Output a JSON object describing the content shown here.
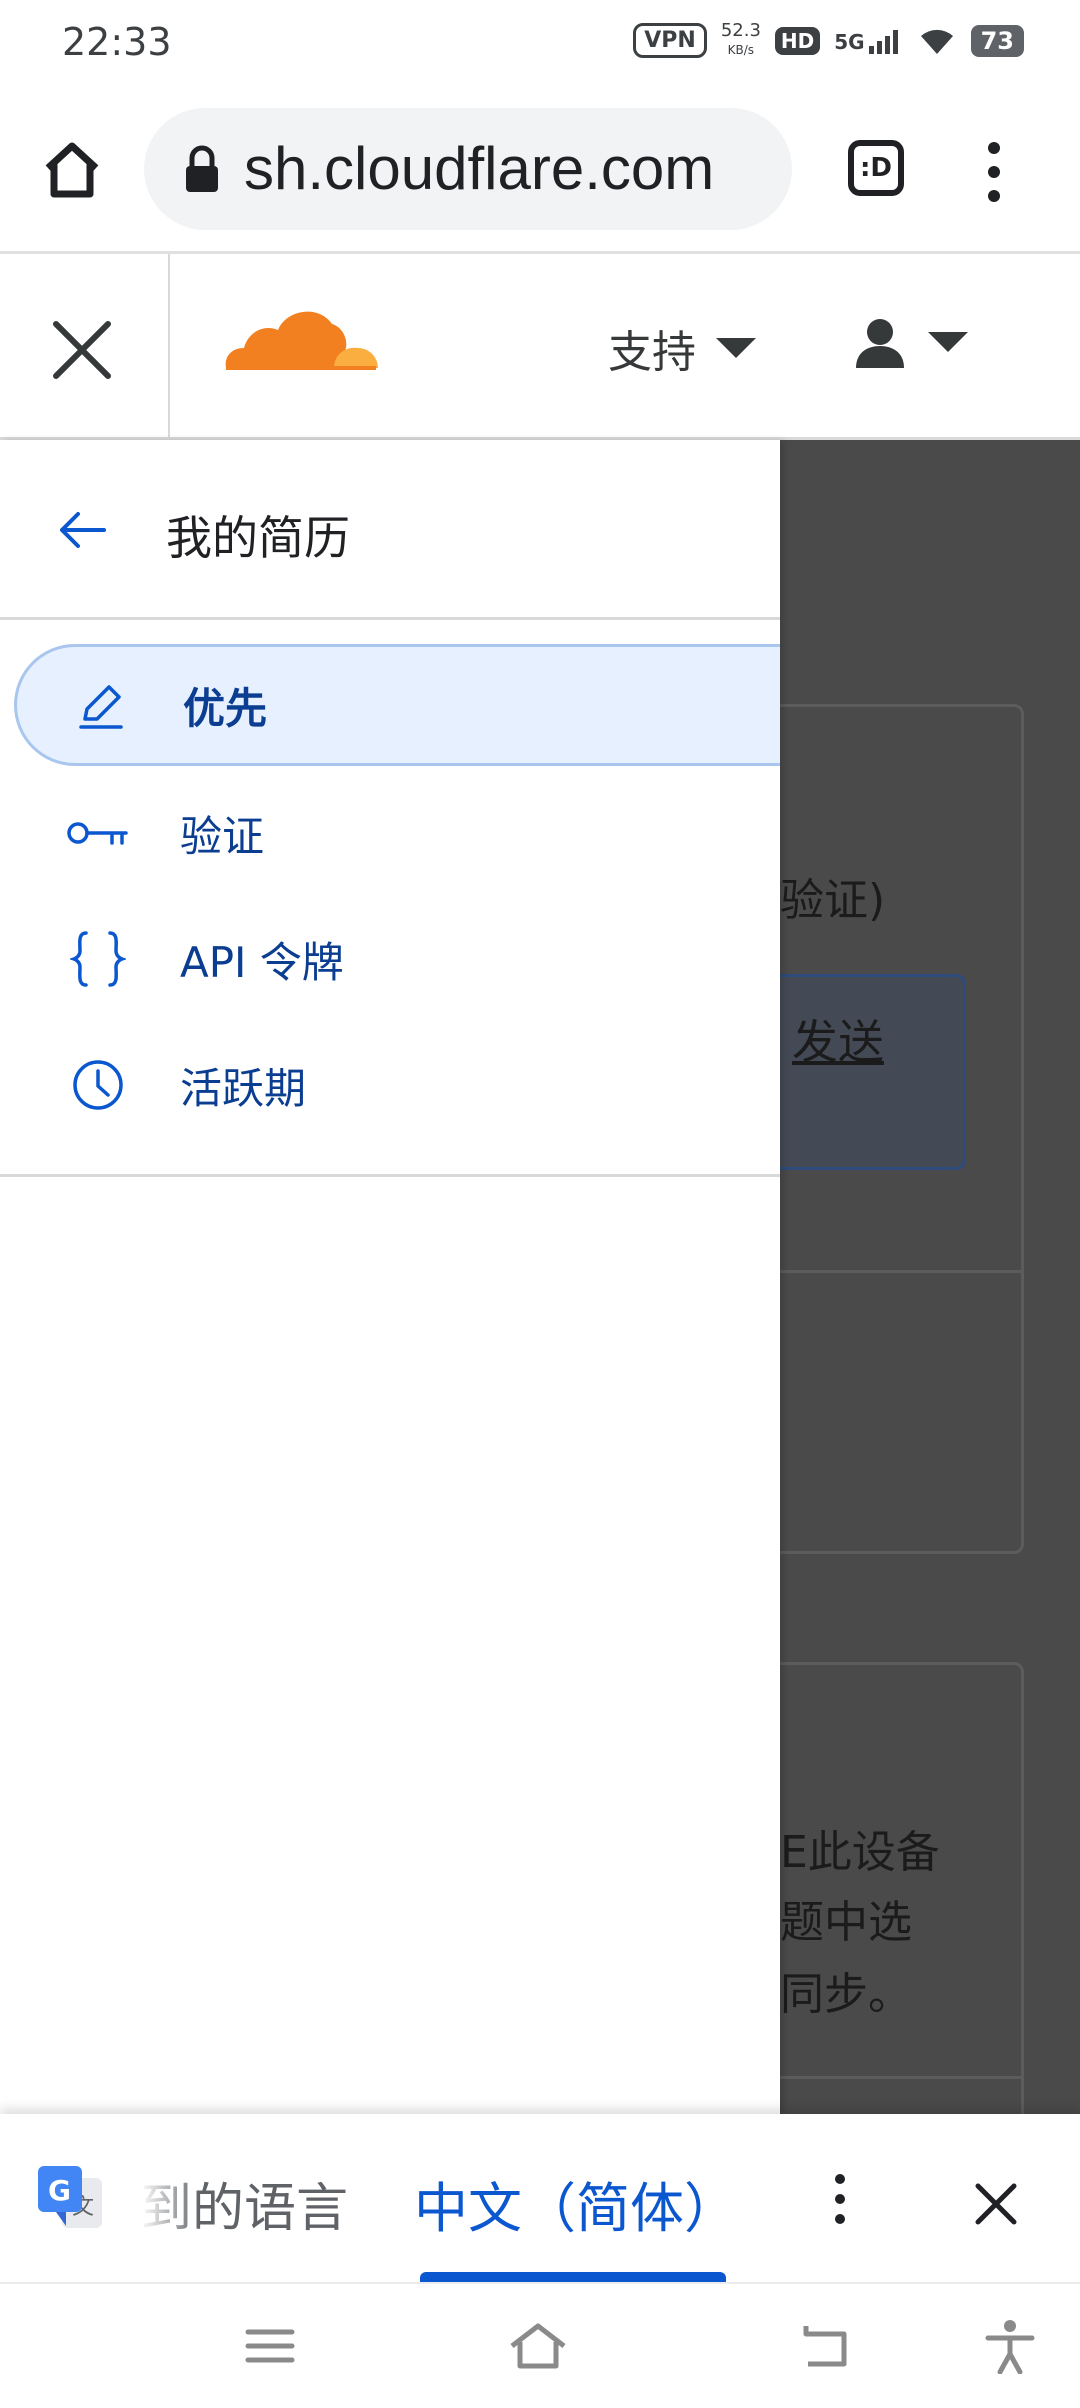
{
  "status_bar": {
    "time": "22:33",
    "vpn": "VPN",
    "net_speed_value": "52.3",
    "net_speed_unit": "KB/s",
    "hd": "HD",
    "network": "5G",
    "battery": "73"
  },
  "browser": {
    "url": "sh.cloudflare.com",
    "tab_button_label": ":D"
  },
  "site_header": {
    "support_label": "支持"
  },
  "drawer": {
    "title": "我的简历",
    "items": [
      {
        "label": "优先",
        "icon": "pencil-icon",
        "active": true
      },
      {
        "label": "验证",
        "icon": "key-icon",
        "active": false
      },
      {
        "label": "API 令牌",
        "icon": "braces-icon",
        "active": false
      },
      {
        "label": "活跃期",
        "icon": "clock-icon",
        "active": false
      }
    ]
  },
  "background_page": {
    "text_verify": "验证)",
    "send_link": "发送",
    "text_line1": "E此设备",
    "text_line2": "题中选",
    "text_line3": "同步。"
  },
  "translate_bar": {
    "source_language": "到的语言",
    "target_language": "中文（简体）"
  },
  "colors": {
    "accent_blue": "#0b57d0",
    "cloudflare_orange": "#f38020",
    "cloudflare_light_orange": "#faae40",
    "active_bg": "#e6f0ff"
  }
}
